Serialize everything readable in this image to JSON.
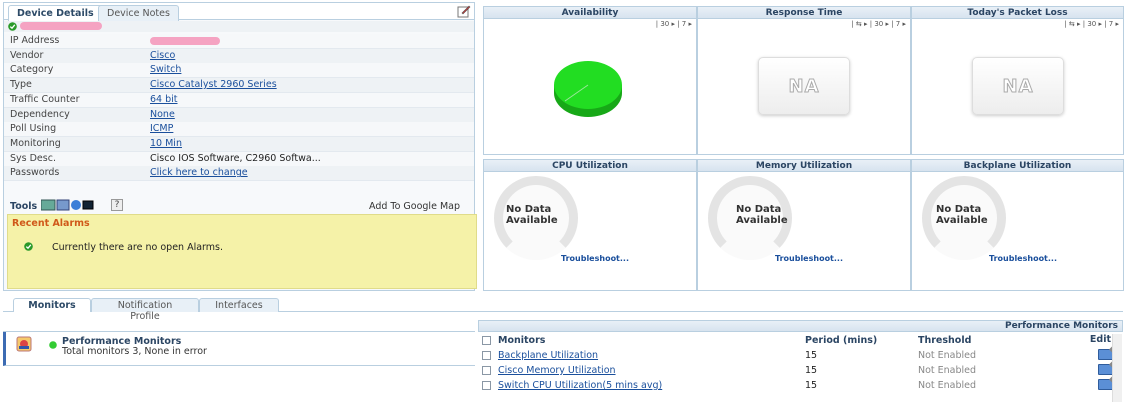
{
  "details": {
    "tabs": [
      "Device Details",
      "Device Notes"
    ],
    "rows": [
      {
        "label": "IP Address",
        "value": ""
      },
      {
        "label": "Vendor",
        "value": "Cisco",
        "link": true
      },
      {
        "label": "Category",
        "value": "Switch",
        "link": true
      },
      {
        "label": "Type",
        "value": "Cisco Catalyst 2960 Series",
        "link": true
      },
      {
        "label": "Traffic Counter",
        "value": "64 bit",
        "link": true
      },
      {
        "label": "Dependency",
        "value": "None",
        "link": true
      },
      {
        "label": "Poll Using",
        "value": "ICMP",
        "link": true
      },
      {
        "label": "Monitoring",
        "value": "10   Min",
        "link": true
      },
      {
        "label": "Sys Desc.",
        "value": "Cisco IOS Software, C2960 Softwa...",
        "link": false
      },
      {
        "label": "Passwords",
        "value": "Click here to change",
        "link": true
      }
    ],
    "tools_label": "Tools",
    "help_label": "?",
    "google_map": "Add To Google Map",
    "alarms_title": "Recent Alarms",
    "alarms_text": "Currently there are no open Alarms."
  },
  "panels": {
    "availability": {
      "title": "Availability",
      "ctl": "| 30 ▸ | 7 ▸"
    },
    "response": {
      "title": "Response Time",
      "ctl": "| ⇆ ▸ | 30 ▸ | 7 ▸",
      "na": "NA"
    },
    "packet": {
      "title": "Today's Packet Loss",
      "ctl": "| ⇆ ▸ | 30 ▸ | 7 ▸",
      "na": "NA"
    },
    "cpu": {
      "title": "CPU Utilization",
      "nodata": "No Data\nAvailable",
      "ts": "Troubleshoot..."
    },
    "memory": {
      "title": "Memory Utilization",
      "nodata": "No Data\nAvailable",
      "ts": "Troubleshoot..."
    },
    "backplane": {
      "title": "Backplane Utilization",
      "nodata": "No Data\nAvailable",
      "ts": "Troubleshoot..."
    }
  },
  "bottom_tabs": [
    "Monitors",
    "Notification Profile",
    "Interfaces"
  ],
  "monitor_group": {
    "title": "Performance Monitors",
    "subtitle": "Total monitors 3, None in error"
  },
  "perf": {
    "header": "Performance Monitors",
    "columns": [
      "Monitors",
      "Period (mins)",
      "Threshold",
      "Edit"
    ],
    "rows": [
      {
        "name": "Backplane Utilization",
        "period": "15",
        "threshold": "Not Enabled"
      },
      {
        "name": "Cisco Memory Utilization",
        "period": "15",
        "threshold": "Not Enabled"
      },
      {
        "name": "Switch CPU Utilization(5 mins avg)",
        "period": "15",
        "threshold": "Not Enabled"
      }
    ]
  },
  "colors": {
    "accent": "#1a4f9c",
    "alarm_bg": "#f5f2a8",
    "pie": "#22dd22",
    "mask": "#f5a3c2"
  }
}
